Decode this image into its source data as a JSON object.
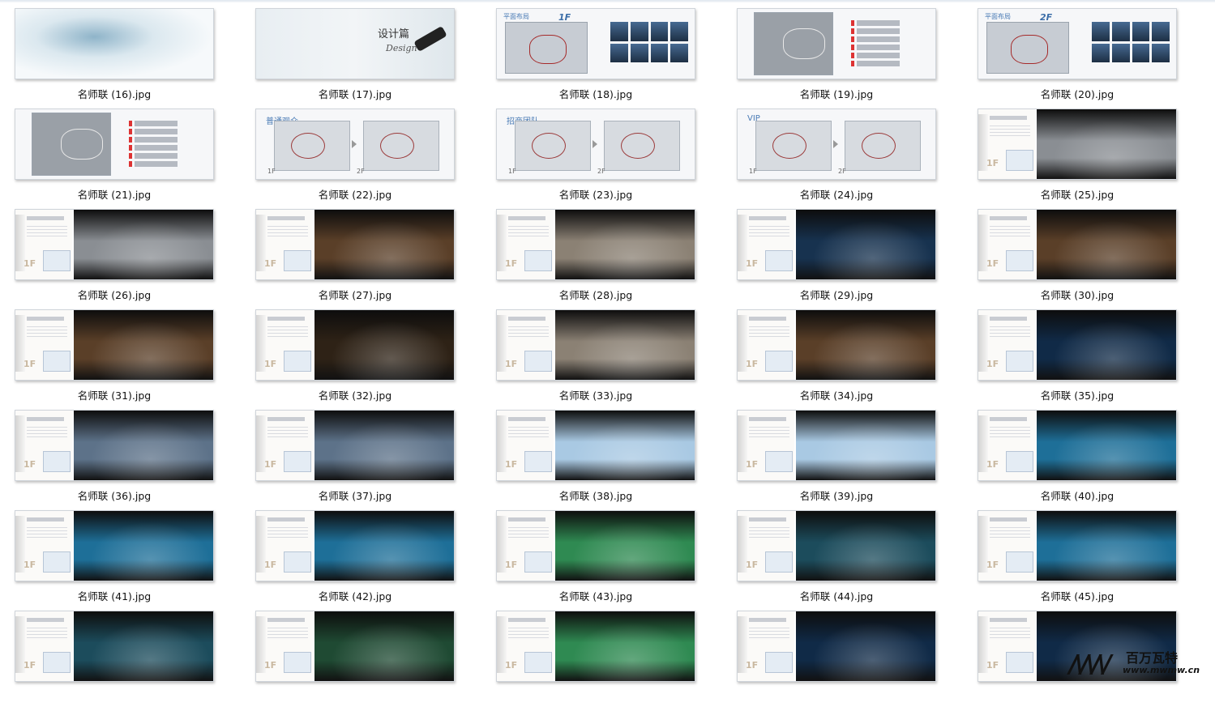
{
  "watermark": {
    "brand_cn": "百万瓦特",
    "url": "www.mwmw.cn"
  },
  "files": [
    {
      "name": "名师联 (16).jpg",
      "kind": "intro"
    },
    {
      "name": "名师联 (17).jpg",
      "kind": "design",
      "title": "设计篇",
      "subtitle": "Design"
    },
    {
      "name": "名师联 (18).jpg",
      "kind": "floorplan",
      "label": "平面布局",
      "floor": "1F"
    },
    {
      "name": "名师联 (19).jpg",
      "kind": "legend-plan"
    },
    {
      "name": "名师联 (20).jpg",
      "kind": "floorplan",
      "label": "平面布局",
      "floor": "2F"
    },
    {
      "name": "名师联 (21).jpg",
      "kind": "legend-plan"
    },
    {
      "name": "名师联 (22).jpg",
      "kind": "route",
      "label": "普通观众",
      "f1": "1F",
      "f2": "2F"
    },
    {
      "name": "名师联 (23).jpg",
      "kind": "route",
      "label": "招商团队",
      "f1": "1F",
      "f2": "2F"
    },
    {
      "name": "名师联 (24).jpg",
      "kind": "route",
      "label": "VIP",
      "f1": "1F",
      "f2": "2F"
    },
    {
      "name": "名师联 (25).jpg",
      "kind": "scene",
      "floor": "1F",
      "tone": "gray"
    },
    {
      "name": "名师联 (26).jpg",
      "kind": "scene",
      "floor": "1F",
      "tone": "gray"
    },
    {
      "name": "名师联 (27).jpg",
      "kind": "scene",
      "floor": "1F",
      "tone": "brown"
    },
    {
      "name": "名师联 (28).jpg",
      "kind": "scene",
      "floor": "1F",
      "tone": "stone"
    },
    {
      "name": "名师联 (29).jpg",
      "kind": "scene",
      "floor": "1F",
      "tone": "blue-dark"
    },
    {
      "name": "名师联 (30).jpg",
      "kind": "scene",
      "floor": "1F",
      "tone": "brown"
    },
    {
      "name": "名师联 (31).jpg",
      "kind": "scene",
      "floor": "1F",
      "tone": "brown"
    },
    {
      "name": "名师联 (32).jpg",
      "kind": "scene",
      "floor": "1F",
      "tone": "brown-dark"
    },
    {
      "name": "名师联 (33).jpg",
      "kind": "scene",
      "floor": "1F",
      "tone": "stone"
    },
    {
      "name": "名师联 (34).jpg",
      "kind": "scene",
      "floor": "1F",
      "tone": "brown"
    },
    {
      "name": "名师联 (35).jpg",
      "kind": "scene",
      "floor": "1F",
      "tone": "navy"
    },
    {
      "name": "名师联 (36).jpg",
      "kind": "scene",
      "floor": "1F",
      "tone": "steel"
    },
    {
      "name": "名师联 (37).jpg",
      "kind": "scene",
      "floor": "1F",
      "tone": "steel"
    },
    {
      "name": "名师联 (38).jpg",
      "kind": "scene",
      "floor": "1F",
      "tone": "light-blue"
    },
    {
      "name": "名师联 (39).jpg",
      "kind": "scene",
      "floor": "1F",
      "tone": "light-blue"
    },
    {
      "name": "名师联 (40).jpg",
      "kind": "scene",
      "floor": "1F",
      "tone": "cyan"
    },
    {
      "name": "名师联 (41).jpg",
      "kind": "scene",
      "floor": "1F",
      "tone": "cyan"
    },
    {
      "name": "名师联 (42).jpg",
      "kind": "scene",
      "floor": "1F",
      "tone": "cyan"
    },
    {
      "name": "名师联 (43).jpg",
      "kind": "scene",
      "floor": "1F",
      "tone": "green"
    },
    {
      "name": "名师联 (44).jpg",
      "kind": "scene",
      "floor": "1F",
      "tone": "teal-dark"
    },
    {
      "name": "名师联 (45).jpg",
      "kind": "scene",
      "floor": "1F",
      "tone": "cyan"
    },
    {
      "name": "",
      "kind": "scene",
      "floor": "1F",
      "tone": "teal-dark"
    },
    {
      "name": "",
      "kind": "scene",
      "floor": "1F",
      "tone": "green-dark"
    },
    {
      "name": "",
      "kind": "scene",
      "floor": "1F",
      "tone": "green"
    },
    {
      "name": "",
      "kind": "scene",
      "floor": "1F",
      "tone": "navy"
    },
    {
      "name": "",
      "kind": "scene",
      "floor": "1F",
      "tone": "navy"
    }
  ],
  "tones": {
    "gray": "#8a8e93",
    "brown": "#5a3f28",
    "brown-dark": "#2e2216",
    "stone": "#8b8174",
    "blue-dark": "#17324f",
    "navy": "#102a47",
    "steel": "#5d7289",
    "light-blue": "#a9c9e3",
    "cyan": "#1e6f98",
    "green": "#2f8a52",
    "green-dark": "#1f4a33",
    "teal-dark": "#1c4c5c"
  }
}
